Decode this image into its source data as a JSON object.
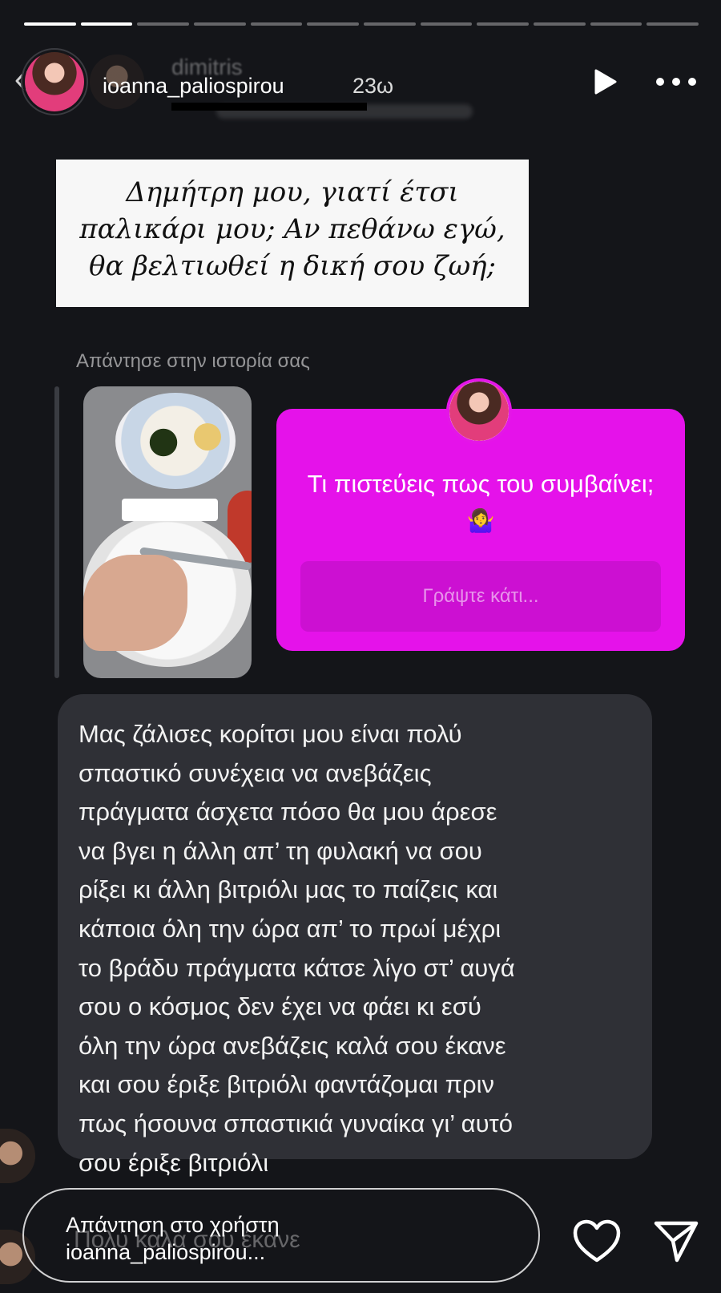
{
  "progress": {
    "segments": 12,
    "completed": 2
  },
  "header": {
    "username": "ioanna_paliospirou",
    "time": "23ω",
    "background_username": "dimitris"
  },
  "quote": {
    "lines": [
      "Δημήτρη μου, γιατί έτσι",
      "παλικάρι μου; Αν πεθάνω εγώ,",
      "θα βελτιωθεί η δική σου ζωή;"
    ]
  },
  "reply_context": {
    "label": "Απάντησε στην ιστορία σας"
  },
  "question_sticker": {
    "question": "Τι πιστεύεις πως του συμβαίνει;",
    "emoji": "🤷‍♀️",
    "input_placeholder": "Γράψτε κάτι...",
    "background_color": "#e512ea"
  },
  "message": {
    "lines": [
      "Μας ζάλισες κορίτσι μου είναι πολύ",
      "σπαστικό συνέχεια να ανεβάζεις",
      "πράγματα άσχετα πόσο θα μου άρεσε",
      "να βγει η άλλη απ’ τη φυλακή να σου",
      "ρίξει κι άλλη βιτριόλι μας το παίζεις και",
      "κάποια όλη την ώρα απ’ το πρωί μέχρι",
      "το βράδυ πράγματα κάτσε λίγο στ’ αυγά",
      "σου ο κόσμος δεν έχει να φάει κι εσύ",
      "όλη την ώρα ανεβάζεις καλά σου έκανε",
      "και σου έριξε βιτριόλι φαντάζομαι πριν",
      "πως ήσουνα σπαστικιά γυναίκα γι’ αυτό",
      "σου έριξε βιτριόλι"
    ]
  },
  "reply_input": {
    "placeholder_line1": "Απάντηση στο χρήστη",
    "placeholder_line2": "ioanna_paliospirou...",
    "ghost_text": "Πολύ καλά σου έκανε"
  },
  "icons": {
    "back": "chevron-left-icon",
    "play": "play-icon",
    "more": "more-horizontal-icon",
    "heart": "heart-icon",
    "send": "send-icon"
  }
}
